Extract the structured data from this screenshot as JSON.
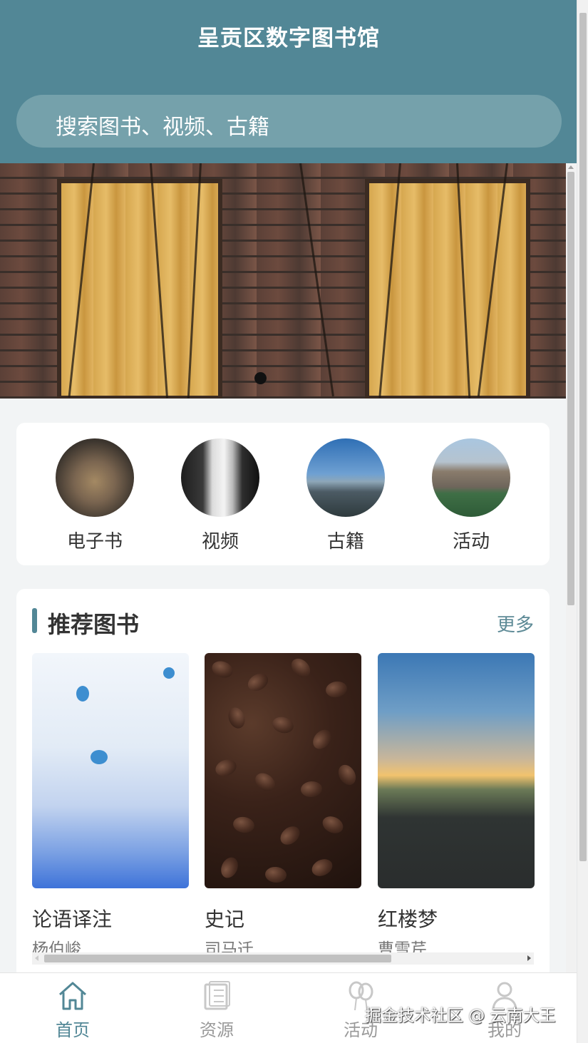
{
  "header": {
    "title": "呈贡区数字图书馆",
    "search_placeholder": "搜索图书、视频、古籍"
  },
  "banner": {
    "active_slide": 1
  },
  "categories": [
    {
      "label": "电子书",
      "icon": "ebook-lion-image"
    },
    {
      "label": "视频",
      "icon": "video-waterfall-image"
    },
    {
      "label": "古籍",
      "icon": "ancient-mountain-image"
    },
    {
      "label": "活动",
      "icon": "activity-castle-image"
    }
  ],
  "recommend": {
    "title": "推荐图书",
    "more": "更多",
    "books": [
      {
        "name": "论语译注",
        "author": "杨伯峻",
        "cover": "jellyfish-cover"
      },
      {
        "name": "史记",
        "author": "司马迁",
        "cover": "coffee-beans-cover"
      },
      {
        "name": "红楼梦",
        "author": "曹雪芹",
        "cover": "road-sunset-cover"
      }
    ]
  },
  "tabbar": {
    "items": [
      {
        "label": "首页",
        "icon": "home-icon",
        "active": true
      },
      {
        "label": "资源",
        "icon": "resource-icon",
        "active": false
      },
      {
        "label": "活动",
        "icon": "activity-icon",
        "active": false
      },
      {
        "label": "我的",
        "icon": "user-icon",
        "active": false
      }
    ]
  },
  "watermark": "掘金技术社区 @ 云南大王",
  "colors": {
    "primary": "#528796",
    "search_bg": "#75a1ab",
    "page_bg": "#f2f4f5"
  }
}
